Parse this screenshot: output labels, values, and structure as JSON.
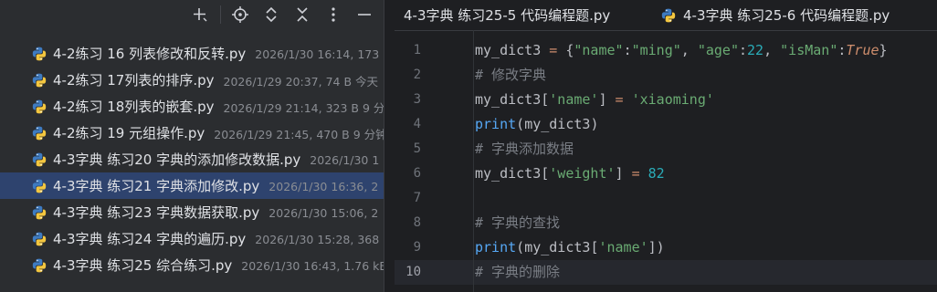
{
  "toolbar": {
    "icons": [
      "add-icon",
      "locate-icon",
      "expand-all-icon",
      "collapse-all-icon",
      "more-icon",
      "minimize-icon"
    ]
  },
  "files": [
    {
      "name": "4-2练习 16 列表修改和反转.py",
      "meta": "2026/1/30 16:14, 173",
      "selected": false
    },
    {
      "name": "4-2练习 17列表的排序.py",
      "meta": "2026/1/29 20:37, 74 B 今天",
      "selected": false
    },
    {
      "name": "4-2练习 18列表的嵌套.py",
      "meta": "2026/1/29 21:14, 323 B 9 分",
      "selected": false
    },
    {
      "name": "4-2练习 19 元组操作.py",
      "meta": "2026/1/29 21:45, 470 B 9 分钟",
      "selected": false
    },
    {
      "name": "4-3字典 练习20 字典的添加修改数据.py",
      "meta": "2026/1/30 1",
      "selected": false
    },
    {
      "name": "4-3字典 练习21 字典添加修改.py",
      "meta": "2026/1/30 16:36, 2",
      "selected": true
    },
    {
      "name": "4-3字典 练习23 字典数据获取.py",
      "meta": "2026/1/30 15:06, 2",
      "selected": false
    },
    {
      "name": "4-3字典 练习24 字典的遍历.py",
      "meta": "2026/1/30 15:28, 368",
      "selected": false
    },
    {
      "name": "4-3字典 练习25 综合练习.py",
      "meta": "2026/1/30 16:43, 1.76 kB",
      "selected": false
    }
  ],
  "tabs": [
    {
      "label": "4-3字典 练习25-5 代码编程题.py",
      "has_icon": false
    },
    {
      "label": "4-3字典 练习25-6 代码编程题.py",
      "has_icon": true
    }
  ],
  "line_numbers": [
    "1",
    "2",
    "3",
    "4",
    "5",
    "6",
    "7",
    "8",
    "9",
    "10"
  ],
  "code": [
    "my_dict3 = {\"name\":\"ming\", \"age\":22, \"isMan\":True}",
    "# 修改字典",
    "my_dict3['name'] = 'xiaoming'",
    "print(my_dict3)",
    "# 字典添加数据",
    "my_dict3['weight'] = 82",
    "",
    "# 字典的查找",
    "print(my_dict3['name'])",
    "# 字典的删除"
  ],
  "active_line": "10"
}
